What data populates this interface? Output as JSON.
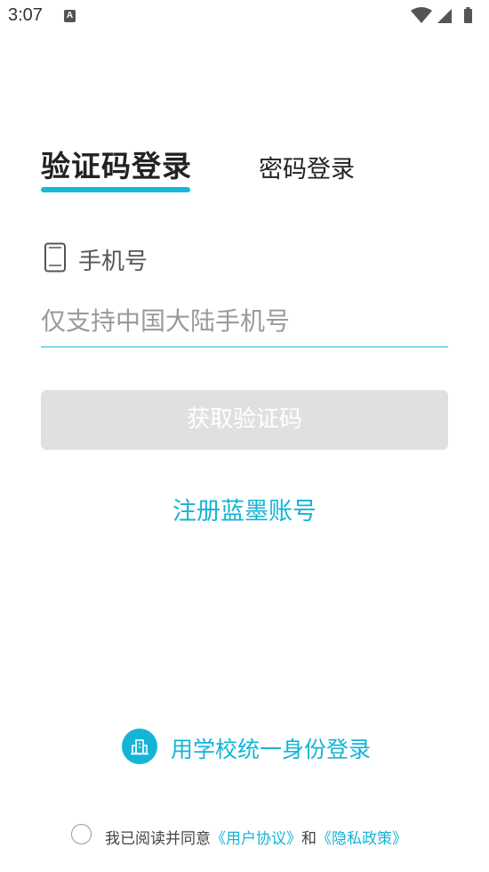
{
  "status_bar": {
    "time": "3:07",
    "notification_icon": "A"
  },
  "tabs": [
    {
      "label": "验证码登录",
      "active": true
    },
    {
      "label": "密码登录",
      "active": false
    }
  ],
  "phone": {
    "label": "手机号",
    "placeholder": "仅支持中国大陆手机号",
    "value": ""
  },
  "get_code_button": "获取验证码",
  "register_link": "注册蓝墨账号",
  "school_login": "用学校统一身份登录",
  "agreement": {
    "prefix": "我已阅读并同意",
    "user_agreement": "《用户协议》",
    "and": "和",
    "privacy_policy": "《隐私政策》",
    "checked": false
  },
  "colors": {
    "accent": "#16b8d8",
    "button_disabled": "#e0e0e0"
  }
}
